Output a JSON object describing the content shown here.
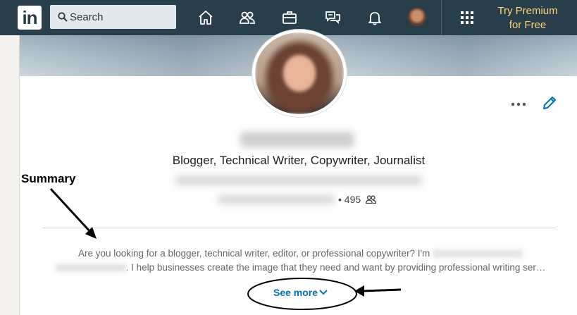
{
  "nav": {
    "logo_text": "in",
    "search_placeholder": "Search",
    "icons": [
      "home-icon",
      "my-network-icon",
      "jobs-icon",
      "messaging-icon",
      "notifications-icon"
    ],
    "premium_line1": "Try Premium",
    "premium_line2": "for Free"
  },
  "profile": {
    "headline": "Blogger, Technical Writer, Copywriter, Journalist",
    "connections_count": "495",
    "summary_line1": "Are you looking for a blogger, technical writer, editor, or professional copywriter? I'm",
    "summary_line2": ". I help businesses create the image that they need and want by providing professional writing ser…",
    "see_more_label": "See more"
  },
  "annotation": {
    "summary_label": "Summary"
  },
  "colors": {
    "nav_bg": "#283e4a",
    "premium": "#f7d77d",
    "link": "#0073b1"
  }
}
